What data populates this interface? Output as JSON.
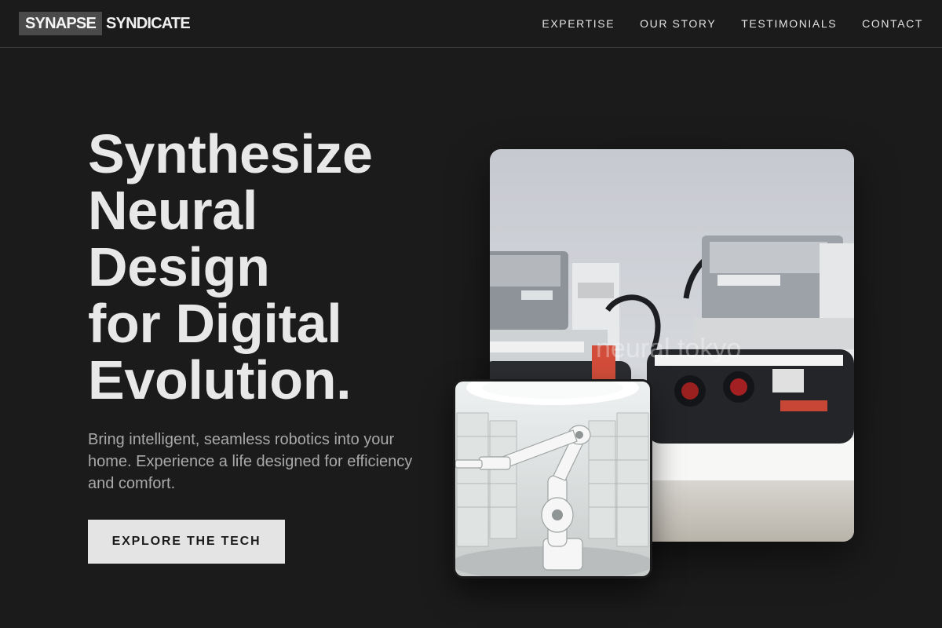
{
  "header": {
    "logo_primary": "SYNAPSE",
    "logo_secondary": "SYNDICATE",
    "nav": [
      {
        "label": "EXPERTISE"
      },
      {
        "label": "OUR STORY"
      },
      {
        "label": "TESTIMONIALS"
      },
      {
        "label": "CONTACT"
      }
    ]
  },
  "hero": {
    "title_lines": [
      "Synthesize",
      "Neural",
      "Design",
      "for Digital",
      "Evolution."
    ],
    "subtitle": "Bring intelligent, seamless robotics into your home. Experience a life designed for efficiency and comfort.",
    "cta_label": "EXPLORE THE TECH"
  },
  "images": {
    "main_watermark": "neural tokyo"
  },
  "colors": {
    "background": "#1b1b1b",
    "text": "#e8e8e8",
    "muted_text": "#a9a9a9",
    "cta_background": "#e4e4e4",
    "logo_box": "#4a4a4a"
  }
}
